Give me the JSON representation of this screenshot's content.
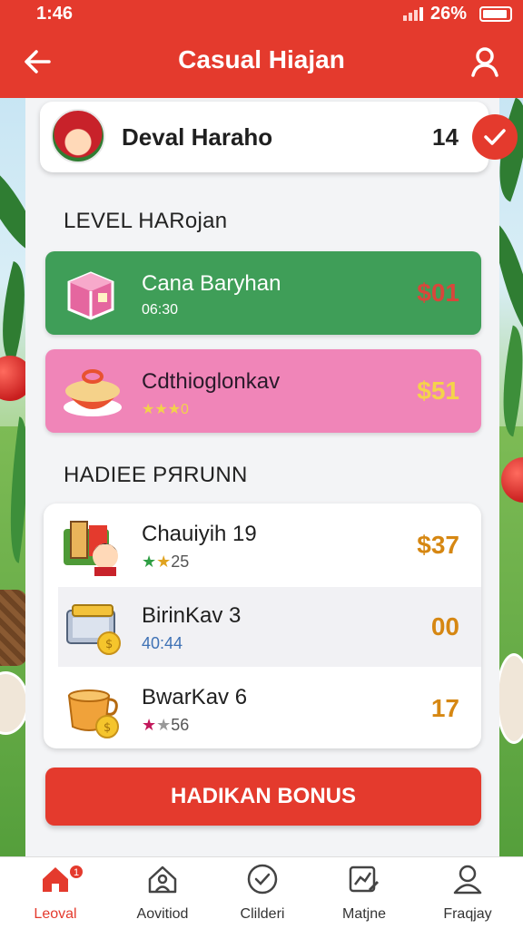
{
  "status_bar": {
    "time": "1:46",
    "battery_text": "26%"
  },
  "app_bar": {
    "title": "Casual Hiajan",
    "back_icon": "back-arrow-icon",
    "profile_icon": "user-icon"
  },
  "profile": {
    "name": "Deval Haraho",
    "count": "14",
    "check_icon": "check-icon"
  },
  "level_section": {
    "title": "LEVEL HARojan",
    "cards": [
      {
        "name": "Cana Baryhan",
        "sub": "06:30",
        "price": "$01",
        "color": "#3f9e58",
        "icon": "gift-box-icon"
      },
      {
        "name": "Cdthioglonkav",
        "sub": "★★★0",
        "price": "$51",
        "color": "#f085b8",
        "icon": "bowl-icon"
      }
    ]
  },
  "hadiee_section": {
    "title": "HADIEE PЯRUNN",
    "items": [
      {
        "name": "Chauiyih 19",
        "sub": "★★25",
        "price": "$37",
        "icon": "character-scene-icon"
      },
      {
        "name": "BirinKav 3",
        "sub": "40:44",
        "price": "00",
        "icon": "chest-coin-icon"
      },
      {
        "name": "BwarKav 6",
        "sub": "★★56",
        "price": "17",
        "icon": "pot-coin-icon"
      }
    ]
  },
  "bonus_button": {
    "label": "HADIKAN BONUS"
  },
  "nav": {
    "badge": "1",
    "items": [
      {
        "label": "Leoval",
        "icon": "home-icon"
      },
      {
        "label": "Aovitiod",
        "icon": "house-person-icon"
      },
      {
        "label": "Clilderi",
        "icon": "check-circle-icon"
      },
      {
        "label": "Matjne",
        "icon": "chart-edit-icon"
      },
      {
        "label": "Fraqjay",
        "icon": "person-icon"
      }
    ]
  },
  "colors": {
    "primary": "#e43a2d",
    "green_card": "#3f9e58",
    "pink_card": "#f085b8",
    "price_gold": "#d68712"
  }
}
